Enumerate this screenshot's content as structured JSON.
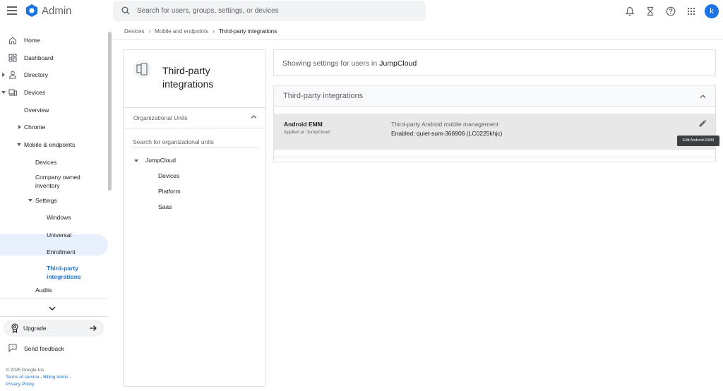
{
  "app": {
    "title": "Admin"
  },
  "search": {
    "placeholder": "Search for users, groups, settings, or devices"
  },
  "user": {
    "initial": "k"
  },
  "sidebar": {
    "items": [
      {
        "label": "Home"
      },
      {
        "label": "Dashboard"
      },
      {
        "label": "Directory"
      },
      {
        "label": "Devices"
      },
      {
        "label": "Overview"
      },
      {
        "label": "Chrome"
      },
      {
        "label": "Mobile & endpoints"
      },
      {
        "label": "Devices"
      },
      {
        "label": "Company owned inventory"
      },
      {
        "label": "Settings"
      },
      {
        "label": "Windows"
      },
      {
        "label": "Universal"
      },
      {
        "label": "Enrollment"
      },
      {
        "label": "Third-party integrations"
      },
      {
        "label": "Audits"
      }
    ],
    "upgrade": "Upgrade",
    "feedback": "Send feedback",
    "copyright": "© 2025 Google Inc.",
    "terms": "Terms of service",
    "billing": "Billing terms",
    "privacy": "Privacy Policy"
  },
  "breadcrumb": [
    "Devices",
    "Mobile and endpoints",
    "Third-party integrations"
  ],
  "ou_panel": {
    "title": "Third-party integrations",
    "header": "Organizational Units",
    "search_placeholder": "Search for organizational units",
    "root": "JumpCloud",
    "children": [
      "Devices",
      "Platform",
      "Saas"
    ]
  },
  "showing": {
    "prefix": "Showing settings for users in",
    "org": "JumpCloud"
  },
  "integrations": {
    "title": "Third-party integrations",
    "row": {
      "name": "Android EMM",
      "applied": "Applied at 'JumpCloud'",
      "description": "Third-party Android mobile management",
      "value": "Enabled: quiet-sum-366906 (LC0225khjc)"
    },
    "tooltip": "Edit Android EMM"
  },
  "colors": {
    "accent": "#1a73e8",
    "active_bg": "#e8f0fe"
  }
}
